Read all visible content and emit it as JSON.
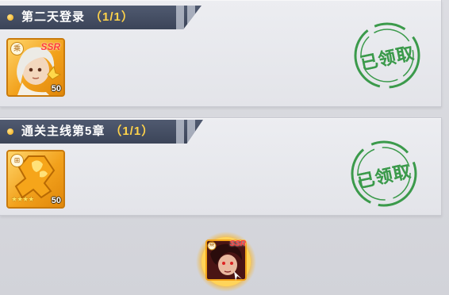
{
  "tasks": [
    {
      "title": "第二天登录",
      "progress": "（1/1）",
      "reward": {
        "rarity": "SSR",
        "badge": "乘",
        "count": "50",
        "icon": "hero-portrait-icon"
      },
      "status": "已领取"
    },
    {
      "title": "通关主线第5章",
      "progress": "（1/1）",
      "reward": {
        "badge": "⊞",
        "count": "50",
        "stars": "★★★★",
        "icon": "shard-puzzle-icon"
      },
      "status": "已领取"
    }
  ],
  "featured_reward": {
    "rarity": "SSR",
    "badge": "乘",
    "icon": "hero-portrait-icon"
  },
  "colors": {
    "banner": "#454e63",
    "stamp": "#3b9a4b",
    "item_frame": "#f2a11c"
  }
}
